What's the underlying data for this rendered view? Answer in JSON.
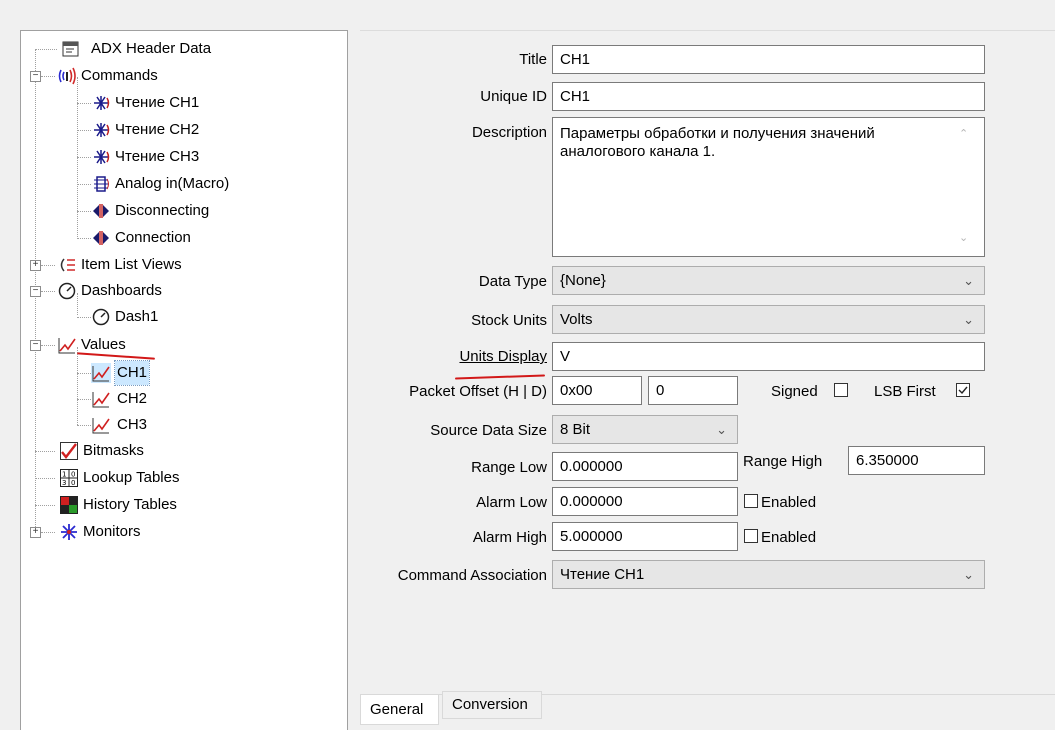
{
  "tree": {
    "items": [
      {
        "label": "ADX Header Data",
        "icon": "header-data-icon"
      },
      {
        "label": "Commands",
        "icon": "commands-icon",
        "expander": "−"
      },
      {
        "label": "Чтение  CH1",
        "icon": "command-read-icon"
      },
      {
        "label": "Чтение CH2",
        "icon": "command-read-icon"
      },
      {
        "label": "Чтение CH3",
        "icon": "command-read-icon"
      },
      {
        "label": "Analog in(Macro)",
        "icon": "macro-icon"
      },
      {
        "label": "Disconnecting",
        "icon": "disconnect-icon"
      },
      {
        "label": "Connection",
        "icon": "connection-icon"
      },
      {
        "label": "Item List Views",
        "icon": "item-list-icon",
        "expander": "+"
      },
      {
        "label": "Dashboards",
        "icon": "dashboard-icon",
        "expander": "−"
      },
      {
        "label": "Dash1",
        "icon": "dashboard-icon"
      },
      {
        "label": "Values",
        "icon": "values-icon",
        "expander": "−"
      },
      {
        "label": "CH1",
        "icon": "value-icon"
      },
      {
        "label": "CH2",
        "icon": "value-icon"
      },
      {
        "label": "CH3",
        "icon": "value-icon"
      },
      {
        "label": "Bitmasks",
        "icon": "bitmask-icon"
      },
      {
        "label": "Lookup Tables",
        "icon": "lookup-table-icon"
      },
      {
        "label": "History Tables",
        "icon": "history-table-icon"
      },
      {
        "label": "Monitors",
        "icon": "monitor-icon",
        "expander": "+"
      }
    ]
  },
  "form": {
    "title": {
      "label": "Title",
      "value": "CH1"
    },
    "unique_id": {
      "label": "Unique ID",
      "value": "CH1"
    },
    "description": {
      "label": "Description",
      "value": "Параметры обработки и получения значений аналогового канала 1."
    },
    "data_type": {
      "label": "Data Type",
      "value": "{None}"
    },
    "stock_units": {
      "label": "Stock Units",
      "value": "Volts"
    },
    "units_display": {
      "label": "Units Display",
      "value": "V"
    },
    "packet_offset": {
      "label": "Packet Offset (H | D)",
      "hex": "0x00",
      "dec": "0"
    },
    "signed": {
      "label": "Signed",
      "checked": false
    },
    "lsb_first": {
      "label": "LSB First",
      "checked": true
    },
    "source_data_size": {
      "label": "Source Data Size",
      "value": "8 Bit"
    },
    "range_low": {
      "label": "Range Low",
      "value": "0.000000"
    },
    "range_high": {
      "label": "Range High",
      "value": "6.350000"
    },
    "alarm_low": {
      "label": "Alarm Low",
      "value": "0.000000",
      "enabled_label": "Enabled",
      "enabled": false
    },
    "alarm_high": {
      "label": "Alarm High",
      "value": "5.000000",
      "enabled_label": "Enabled",
      "enabled": false
    },
    "command_association": {
      "label": "Command Association",
      "value": "Чтение  CH1"
    }
  },
  "tabs": [
    {
      "label": "General",
      "active": true
    },
    {
      "label": "Conversion",
      "active": false
    }
  ],
  "colors": {
    "annotation_underline": "#d21818",
    "selection": "#cce8ff"
  }
}
